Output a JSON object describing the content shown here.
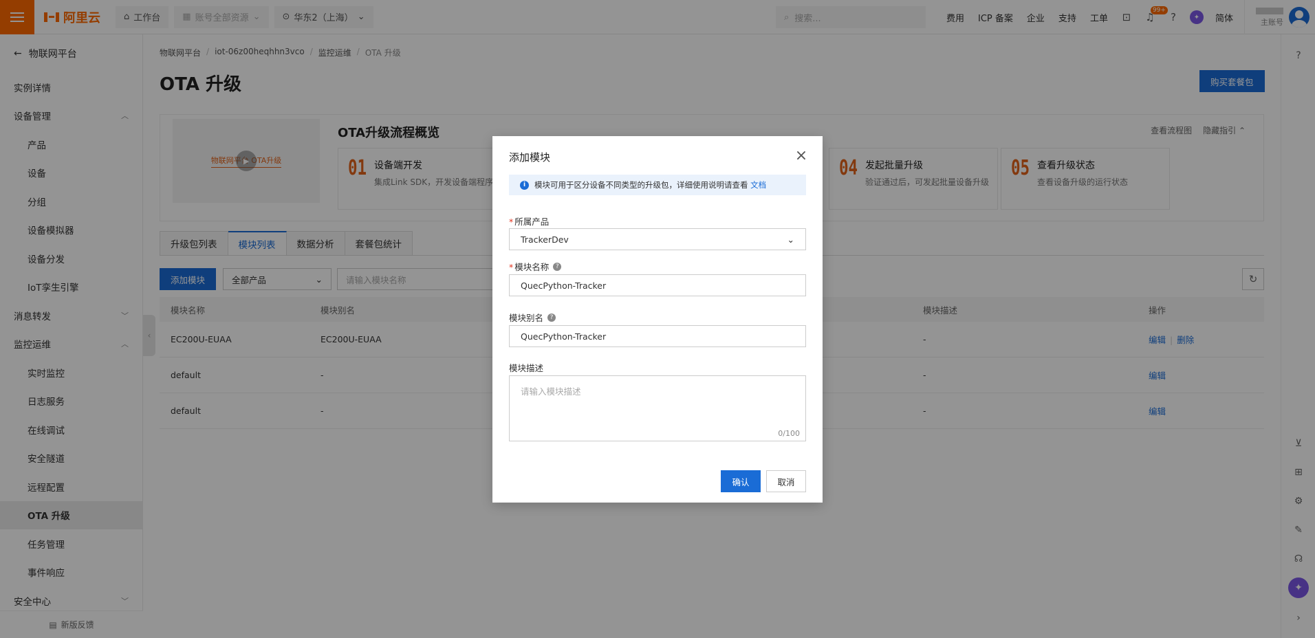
{
  "topbar": {
    "logo": "阿里云",
    "workbench": "工作台",
    "resources": "账号全部资源",
    "region": "华东2（上海）",
    "search_placeholder": "搜索...",
    "links": [
      "费用",
      "ICP 备案",
      "企业",
      "支持",
      "工单"
    ],
    "notification_badge": "99+",
    "language": "简体",
    "account_role": "主账号",
    "accent": "#ff6a00"
  },
  "sidebar": {
    "back": "物联网平台",
    "items": [
      {
        "label": "实例详情",
        "child": false
      },
      {
        "label": "设备管理",
        "child": false,
        "chevron": "up"
      },
      {
        "label": "产品",
        "child": true
      },
      {
        "label": "设备",
        "child": true
      },
      {
        "label": "分组",
        "child": true
      },
      {
        "label": "设备模拟器",
        "child": true
      },
      {
        "label": "设备分发",
        "child": true
      },
      {
        "label": "IoT孪生引擎",
        "child": true
      },
      {
        "label": "消息转发",
        "child": false,
        "chevron": "down"
      },
      {
        "label": "监控运维",
        "child": false,
        "chevron": "up"
      },
      {
        "label": "实时监控",
        "child": true
      },
      {
        "label": "日志服务",
        "child": true
      },
      {
        "label": "在线调试",
        "child": true
      },
      {
        "label": "安全隧道",
        "child": true
      },
      {
        "label": "远程配置",
        "child": true
      },
      {
        "label": "OTA 升级",
        "child": true,
        "active": true
      },
      {
        "label": "任务管理",
        "child": true
      },
      {
        "label": "事件响应",
        "child": true
      },
      {
        "label": "安全中心",
        "child": false,
        "chevron": "down"
      }
    ],
    "feedback": "新版反馈"
  },
  "main": {
    "breadcrumb": [
      "物联网平台",
      "iot-06z00heqhhn3vco",
      "监控运维",
      "OTA 升级"
    ],
    "title": "OTA 升级",
    "buy_button": "购买套餐包",
    "overview": {
      "video_caption": "物联网平台 OTA升级",
      "title": "OTA升级流程概览",
      "view_flow": "查看流程图",
      "hide_guide": "隐藏指引",
      "steps": [
        {
          "num": "01",
          "title": "设备端开发",
          "desc": "集成Link SDK，开发设备端程序"
        },
        {
          "num": "04",
          "title": "发起批量升级",
          "desc": "验证通过后，可发起批量设备升级"
        },
        {
          "num": "05",
          "title": "查看升级状态",
          "desc": "查看设备升级的运行状态"
        }
      ]
    },
    "tabs": [
      "升级包列表",
      "模块列表",
      "数据分析",
      "套餐包统计"
    ],
    "active_tab": 1,
    "toolbar": {
      "add_button": "添加模块",
      "product_filter": "全部产品",
      "name_placeholder": "请输入模块名称"
    },
    "table": {
      "headers": [
        "模块名称",
        "模块别名",
        "模块描述",
        "操作"
      ],
      "rows": [
        {
          "name": "EC200U-EUAA",
          "alias": "EC200U-EUAA",
          "desc": "-",
          "ops": [
            "编辑",
            "删除"
          ]
        },
        {
          "name": "default",
          "alias": "-",
          "desc": "-",
          "ops": [
            "编辑"
          ]
        },
        {
          "name": "default",
          "alias": "-",
          "desc": "-",
          "ops": [
            "编辑"
          ]
        }
      ]
    }
  },
  "modal": {
    "title": "添加模块",
    "notice_text": "模块可用于区分设备不同类型的升级包，详细使用说明请查看",
    "notice_link": "文档",
    "product_label": "所属产品",
    "product_value": "TrackerDev",
    "module_name_label": "模块名称",
    "module_name_value": "QuecPython-Tracker",
    "alias_label": "模块别名",
    "alias_value": "QuecPython-Tracker",
    "desc_label": "模块描述",
    "desc_placeholder": "请输入模块描述",
    "desc_count": "0/100",
    "confirm": "确认",
    "cancel": "取消"
  }
}
